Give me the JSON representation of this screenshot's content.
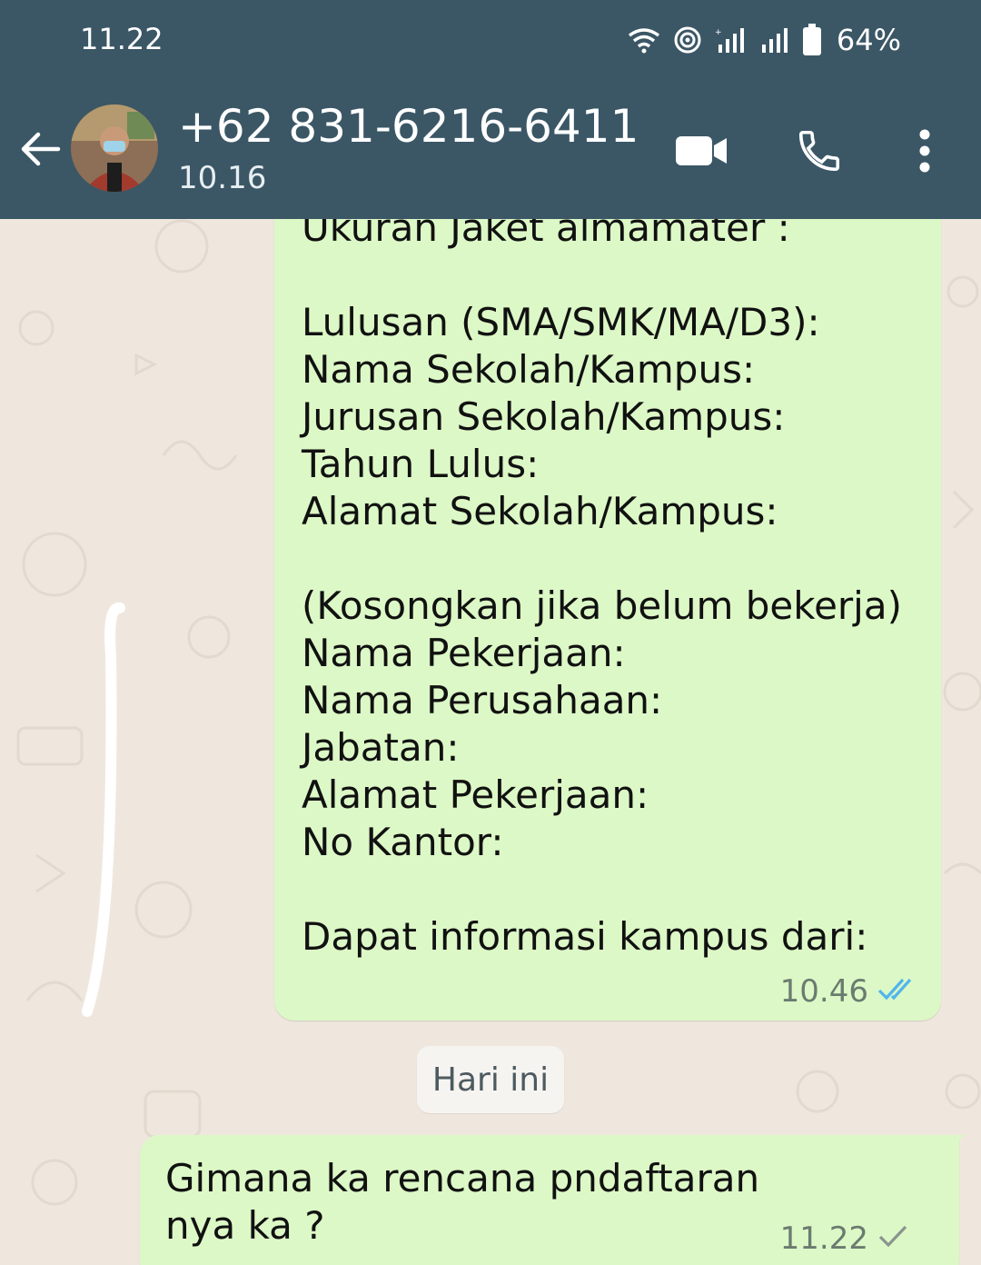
{
  "status_bar": {
    "time": "11.22",
    "battery": "64%"
  },
  "header": {
    "contact_name": "+62 831-6216-6411",
    "subtitle": "10.16"
  },
  "messages": [
    {
      "lines": [
        "Ukuran Jaket almamater :",
        "",
        "Lulusan (SMA/SMK/MA/D3):",
        "Nama Sekolah/Kampus:",
        "Jurusan Sekolah/Kampus:",
        "Tahun Lulus:",
        "Alamat Sekolah/Kampus:",
        "",
        "(Kosongkan jika belum bekerja)",
        "Nama Pekerjaan:",
        "Nama Perusahaan:",
        "Jabatan:",
        "Alamat Pekerjaan:",
        "No Kantor:",
        "",
        "Dapat informasi kampus dari:"
      ],
      "time": "10.46",
      "status_icon": "double-check-icon",
      "status_color": "#4fb6ec"
    },
    {
      "text": "Gimana ka rencana pndaftaran nya ka ?",
      "time": "11.22",
      "status_icon": "single-check-icon",
      "status_color": "#8a958f"
    }
  ],
  "date_separator": "Hari ini",
  "colors": {
    "header": "#3b5766",
    "outgoing_bubble": "#dcf8c6",
    "background": "#efe7de"
  }
}
